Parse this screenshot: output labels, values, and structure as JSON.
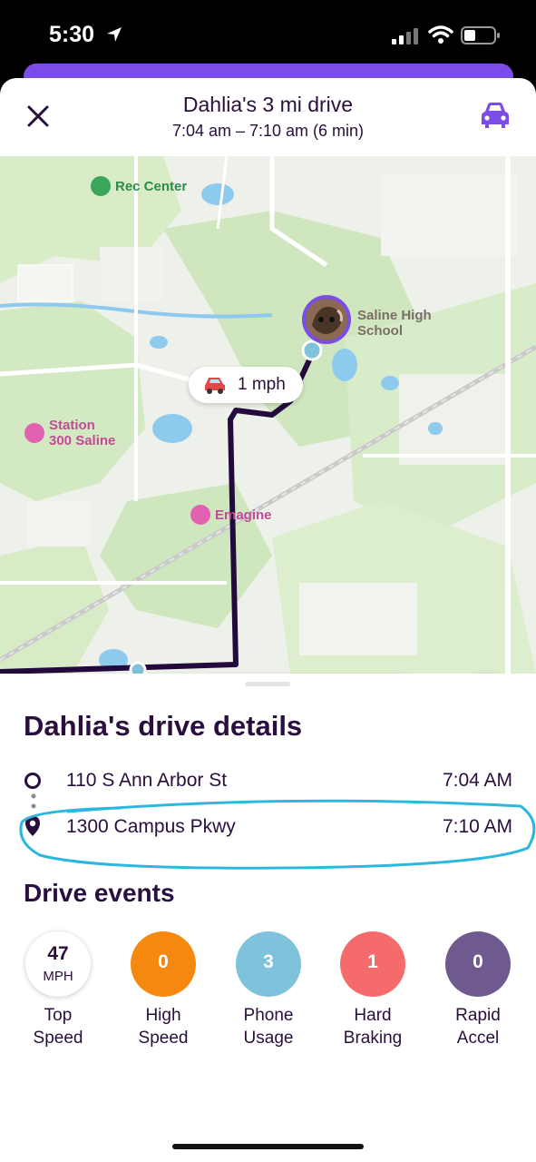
{
  "status": {
    "time": "5:30"
  },
  "header": {
    "title": "Dahlia's 3 mi drive",
    "subtitle": "7:04 am – 7:10 am (6 min)",
    "close_icon": "close-icon",
    "car_icon": "car-icon"
  },
  "map": {
    "speed_label": "1 mph",
    "pois": {
      "rec_center": "Rec Center",
      "saline_high_1": "Saline High",
      "saline_high_2": "School",
      "station_1": "Station",
      "station_2": "300 Saline",
      "emagine": "Emagine"
    },
    "playback_progress": 0.93
  },
  "details": {
    "title": "Dahlia's drive details",
    "start": {
      "address": "110 S Ann Arbor St",
      "time": "7:04 AM"
    },
    "end": {
      "address": "1300 Campus Pkwy",
      "time": "7:10 AM"
    }
  },
  "events": {
    "title": "Drive events",
    "items": [
      {
        "value": "47",
        "unit": "MPH",
        "line1": "Top",
        "line2": "Speed",
        "color": "#ffffff"
      },
      {
        "value": "0",
        "line1": "High",
        "line2": "Speed",
        "color": "#f5890f"
      },
      {
        "value": "3",
        "line1": "Phone",
        "line2": "Usage",
        "color": "#7ec2dc"
      },
      {
        "value": "1",
        "line1": "Hard",
        "line2": "Braking",
        "color": "#f56b6b"
      },
      {
        "value": "0",
        "line1": "Rapid",
        "line2": "Accel",
        "color": "#6e5a8f"
      }
    ]
  },
  "colors": {
    "accent": "#7b4ce6",
    "text": "#2a0e3d",
    "route": "#230a3c",
    "annotation": "#2bb8e0"
  }
}
